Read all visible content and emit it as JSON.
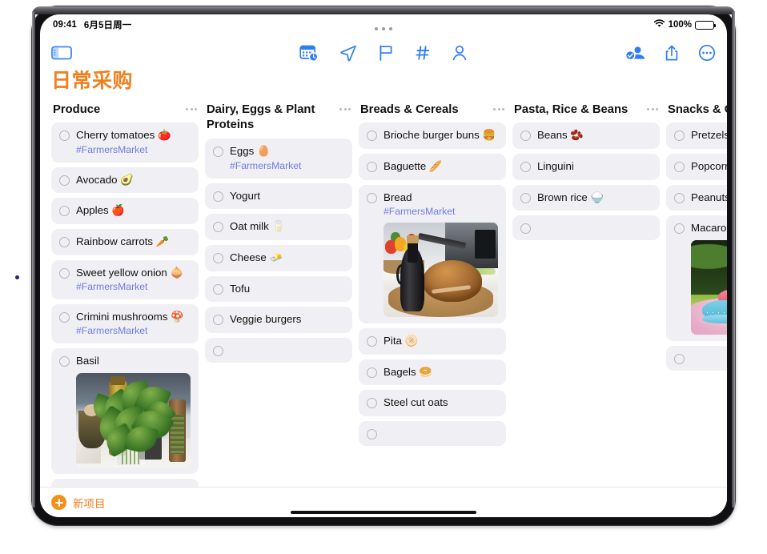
{
  "status_bar": {
    "time": "09:41",
    "date": "6月5日周一",
    "battery_percent": "100%",
    "wifi_icon": "wifi-icon",
    "battery_icon": "battery-full-icon"
  },
  "multitask_indicator": "multitasking-handle-icon",
  "toolbar": {
    "sidebar_toggle_icon": "sidebar-toggle-icon",
    "center_buttons": [
      {
        "icon": "calendar-clock-icon",
        "label": "Scheduled"
      },
      {
        "icon": "paper-plane-icon",
        "label": "Send"
      },
      {
        "icon": "flag-icon",
        "label": "Flag"
      },
      {
        "icon": "hashtag-icon",
        "label": "Tag"
      },
      {
        "icon": "person-icon",
        "label": "Mention"
      }
    ],
    "right_buttons": [
      {
        "icon": "collaborate-person-check-icon",
        "label": "Collaborate"
      },
      {
        "icon": "share-icon",
        "label": "Share"
      },
      {
        "icon": "more-ellipsis-circle-icon",
        "label": "More"
      }
    ]
  },
  "document": {
    "title": "日常采购",
    "title_color": "#F08020"
  },
  "columns": [
    {
      "title": "Produce",
      "menu_icon": "ellipsis-icon",
      "items": [
        {
          "text": "Cherry tomatoes 🍅",
          "tag": "#FarmersMarket"
        },
        {
          "text": "Avocado 🥑"
        },
        {
          "text": "Apples 🍎"
        },
        {
          "text": "Rainbow carrots 🥕"
        },
        {
          "text": "Sweet yellow onion 🧅",
          "tag": "#FarmersMarket"
        },
        {
          "text": "Crimini mushrooms 🍄",
          "tag": "#FarmersMarket"
        },
        {
          "text": "Basil",
          "photo": "basil-in-glass-photo"
        },
        {
          "text": "",
          "empty": true
        }
      ]
    },
    {
      "title": "Dairy, Eggs & Plant Proteins",
      "menu_icon": "ellipsis-icon",
      "items": [
        {
          "text": "Eggs 🥚",
          "tag": "#FarmersMarket"
        },
        {
          "text": "Yogurt"
        },
        {
          "text": "Oat milk 🥛"
        },
        {
          "text": "Cheese 🧈"
        },
        {
          "text": "Tofu"
        },
        {
          "text": "Veggie burgers"
        },
        {
          "text": "",
          "empty": true
        }
      ]
    },
    {
      "title": "Breads & Cereals",
      "menu_icon": "ellipsis-icon",
      "items": [
        {
          "text": "Brioche burger buns 🍔"
        },
        {
          "text": "Baguette 🥖"
        },
        {
          "text": "Bread",
          "tag": "#FarmersMarket",
          "photo": "sourdough-bread-photo"
        },
        {
          "text": "Pita 🫓"
        },
        {
          "text": "Bagels 🥯"
        },
        {
          "text": "Steel cut oats"
        },
        {
          "text": "",
          "empty": true
        }
      ]
    },
    {
      "title": "Pasta, Rice & Beans",
      "menu_icon": "ellipsis-icon",
      "items": [
        {
          "text": "Beans 🫘"
        },
        {
          "text": "Linguini"
        },
        {
          "text": "Brown rice 🍚"
        },
        {
          "text": "",
          "empty": true
        }
      ]
    },
    {
      "title": "Snacks & Ca",
      "menu_icon": "ellipsis-icon",
      "items": [
        {
          "text": "Pretzels 🥨"
        },
        {
          "text": "Popcorn 🍿"
        },
        {
          "text": "Peanuts 🥜"
        },
        {
          "text": "Macarons",
          "photo": "macarons-photo"
        },
        {
          "text": "",
          "empty": true
        }
      ]
    }
  ],
  "bottom_bar": {
    "add_icon": "plus-circle-icon",
    "add_label": "新项目"
  },
  "colors": {
    "accent_orange": "#F08020",
    "tint_blue": "#2F7CF6",
    "tag_purple": "#6E7BE0",
    "item_bg": "#F0F0F4"
  }
}
